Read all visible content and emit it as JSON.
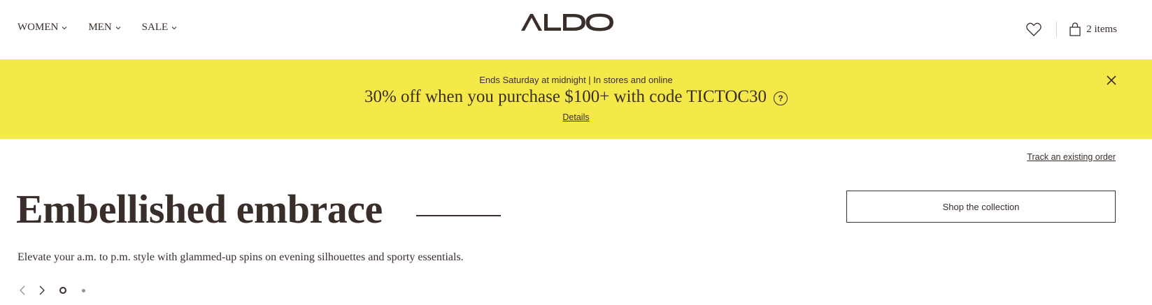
{
  "header": {
    "nav": [
      {
        "label": "WOMEN",
        "icon": "chevron-down-icon"
      },
      {
        "label": "MEN",
        "icon": "chevron-down-icon"
      },
      {
        "label": "SALE",
        "icon": "chevron-down-icon"
      }
    ],
    "logo_text": "ALDO",
    "wishlist_icon": "heart-icon",
    "cart_icon": "shopping-bag-icon",
    "cart_label": "2 items"
  },
  "promo": {
    "subtitle": "Ends Saturday at midnight | In stores and online",
    "headline": "30% off when you purchase $100+ with code TICTOC30",
    "help_glyph": "?",
    "details_link": "Details",
    "background_color": "#f5e94a",
    "close_icon": "close-icon"
  },
  "track_order_link": "Track an existing order",
  "hero": {
    "title": "Embellished embrace",
    "description": "Elevate your a.m. to p.m. style with glammed-up spins on evening silhouettes and sporty essentials.",
    "cta_label": "Shop the collection"
  },
  "carousel": {
    "prev_icon": "chevron-left-icon",
    "next_icon": "chevron-right-icon",
    "active_slide": 1,
    "total_slides": 2
  },
  "colors": {
    "text": "#3a2e2b",
    "banner": "#f5e94a"
  }
}
